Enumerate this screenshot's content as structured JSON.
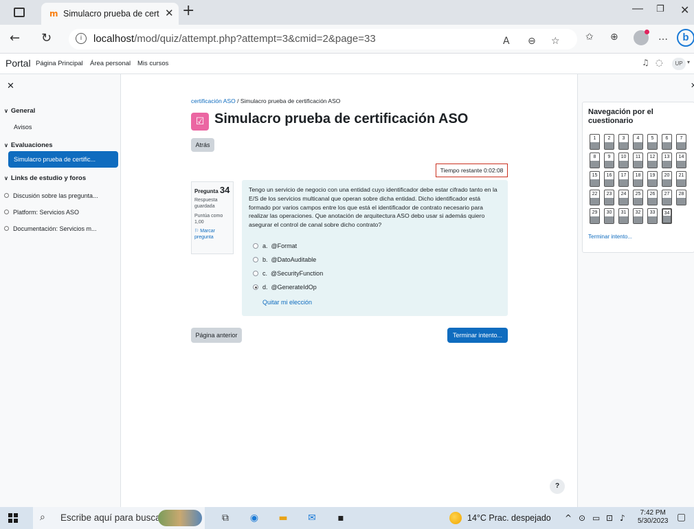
{
  "browser": {
    "tab_title": "Simulacro prueba de certificación",
    "tab_favicon": "moodle-icon",
    "url_host": "localhost",
    "url_path": "/mod/quiz/attempt.php?attempt=3&cmid=2&page=33"
  },
  "topnav": {
    "brand": "Portal",
    "items": [
      "Página Principal",
      "Área personal",
      "Mis cursos"
    ],
    "user_initials": "UP"
  },
  "left_drawer": {
    "sections": [
      {
        "label": "General",
        "items": [
          "Avisos"
        ]
      },
      {
        "label": "Evaluaciones",
        "items": [
          "Simulacro prueba de certific..."
        ]
      },
      {
        "label": "Links de estudio y foros",
        "items": [
          "Discusión sobre las pregunta...",
          "Platform: Servicios ASO",
          "Documentación: Servicios m..."
        ]
      }
    ]
  },
  "main": {
    "breadcrumb": [
      "certificación ASO",
      "Simulacro prueba de certificación ASO"
    ],
    "title": "Simulacro prueba de certificación ASO",
    "back_button": "Atrás",
    "timer": "Tiempo restante 0:02:08",
    "question": {
      "number_label": "Pregunta",
      "number": "34",
      "state": "Respuesta guardada",
      "grade": "Puntúa como 1,00",
      "flag": "Marcar pregunta",
      "text": "Tengo un servicio de negocio con una entidad cuyo identificador debe estar cifrado tanto en la E/S de los servicios multicanal que operan sobre dicha entidad. Dicho identificador está formado por varios campos entre los que está el identificador de contrato necesario para realizar las operaciones. Que anotación de arquitectura ASO debo usar si además quiero asegurar el control de canal sobre dicho contrato?",
      "answers": [
        {
          "letter": "a.",
          "text": "@Format",
          "selected": false
        },
        {
          "letter": "b.",
          "text": "@DatoAuditable",
          "selected": false
        },
        {
          "letter": "c.",
          "text": "@SecurityFunction",
          "selected": false
        },
        {
          "letter": "d.",
          "text": "@GenerateIdOp",
          "selected": true
        }
      ],
      "clear_choice": "Quitar mi elección"
    },
    "prev_button": "Página anterior",
    "finish_button": "Terminar intento...",
    "help": "?"
  },
  "right_drawer": {
    "title": "Navegación por el cuestionario",
    "questions": [
      "1",
      "2",
      "3",
      "4",
      "5",
      "6",
      "7",
      "8",
      "9",
      "10",
      "11",
      "12",
      "13",
      "14",
      "15",
      "16",
      "17",
      "18",
      "19",
      "20",
      "21",
      "22",
      "23",
      "24",
      "25",
      "26",
      "27",
      "28",
      "29",
      "30",
      "31",
      "32",
      "33",
      "34"
    ],
    "current": "34",
    "finish_link": "Terminar intento..."
  },
  "taskbar": {
    "search_placeholder": "Escribe aquí para buscar",
    "weather": "14°C  Prac. despejado",
    "time": "7:42 PM",
    "date": "5/30/2023"
  },
  "colors": {
    "accent": "#0f6cbf",
    "quiz_icon": "#eb66a2",
    "timer_border": "#ca3120",
    "question_bg": "#e7f3f5"
  }
}
